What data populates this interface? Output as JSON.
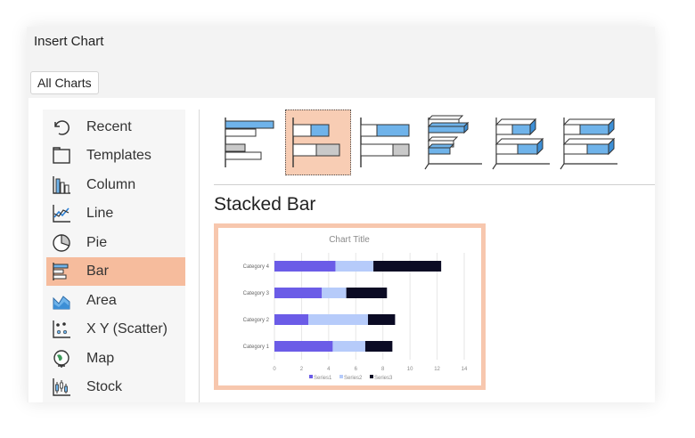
{
  "dialog": {
    "title": "Insert Chart"
  },
  "tabs": [
    {
      "label": "All Charts"
    }
  ],
  "sidebar": {
    "items": [
      {
        "label": "Recent",
        "icon": "recent-icon"
      },
      {
        "label": "Templates",
        "icon": "templates-icon"
      },
      {
        "label": "Column",
        "icon": "column-chart-icon"
      },
      {
        "label": "Line",
        "icon": "line-chart-icon"
      },
      {
        "label": "Pie",
        "icon": "pie-chart-icon"
      },
      {
        "label": "Bar",
        "icon": "bar-chart-icon",
        "selected": true
      },
      {
        "label": "Area",
        "icon": "area-chart-icon"
      },
      {
        "label": "X Y (Scatter)",
        "icon": "scatter-chart-icon"
      },
      {
        "label": "Map",
        "icon": "map-chart-icon"
      },
      {
        "label": "Stock",
        "icon": "stock-chart-icon"
      }
    ]
  },
  "gallery": {
    "items": [
      {
        "name": "clustered-bar",
        "selected": false
      },
      {
        "name": "stacked-bar",
        "selected": true
      },
      {
        "name": "100-stacked-bar",
        "selected": false
      },
      {
        "name": "3d-clustered-bar",
        "selected": false
      },
      {
        "name": "3d-stacked-bar",
        "selected": false
      },
      {
        "name": "3d-100-stacked-bar",
        "selected": false
      }
    ]
  },
  "section_title": "Stacked Bar",
  "colors": {
    "accent": "#f6bc9d",
    "series1": "#6b5ce7",
    "series2": "#b6cbfa",
    "series3": "#0b0b24",
    "icon_blue": "#6fb3ea"
  },
  "chart_data": {
    "type": "bar",
    "orientation": "horizontal",
    "stacked": true,
    "title": "Chart Title",
    "categories": [
      "Category 1",
      "Category 2",
      "Category 3",
      "Category 4"
    ],
    "series": [
      {
        "name": "Series1",
        "values": [
          4.3,
          2.5,
          3.5,
          4.5
        ]
      },
      {
        "name": "Series2",
        "values": [
          2.4,
          4.4,
          1.8,
          2.8
        ]
      },
      {
        "name": "Series3",
        "values": [
          2.0,
          2.0,
          3.0,
          5.0
        ]
      }
    ],
    "x_ticks": [
      "0",
      "2",
      "4",
      "6",
      "8",
      "10",
      "12",
      "14"
    ],
    "xlim": [
      0,
      14
    ],
    "grid": true,
    "legend": "bottom"
  }
}
